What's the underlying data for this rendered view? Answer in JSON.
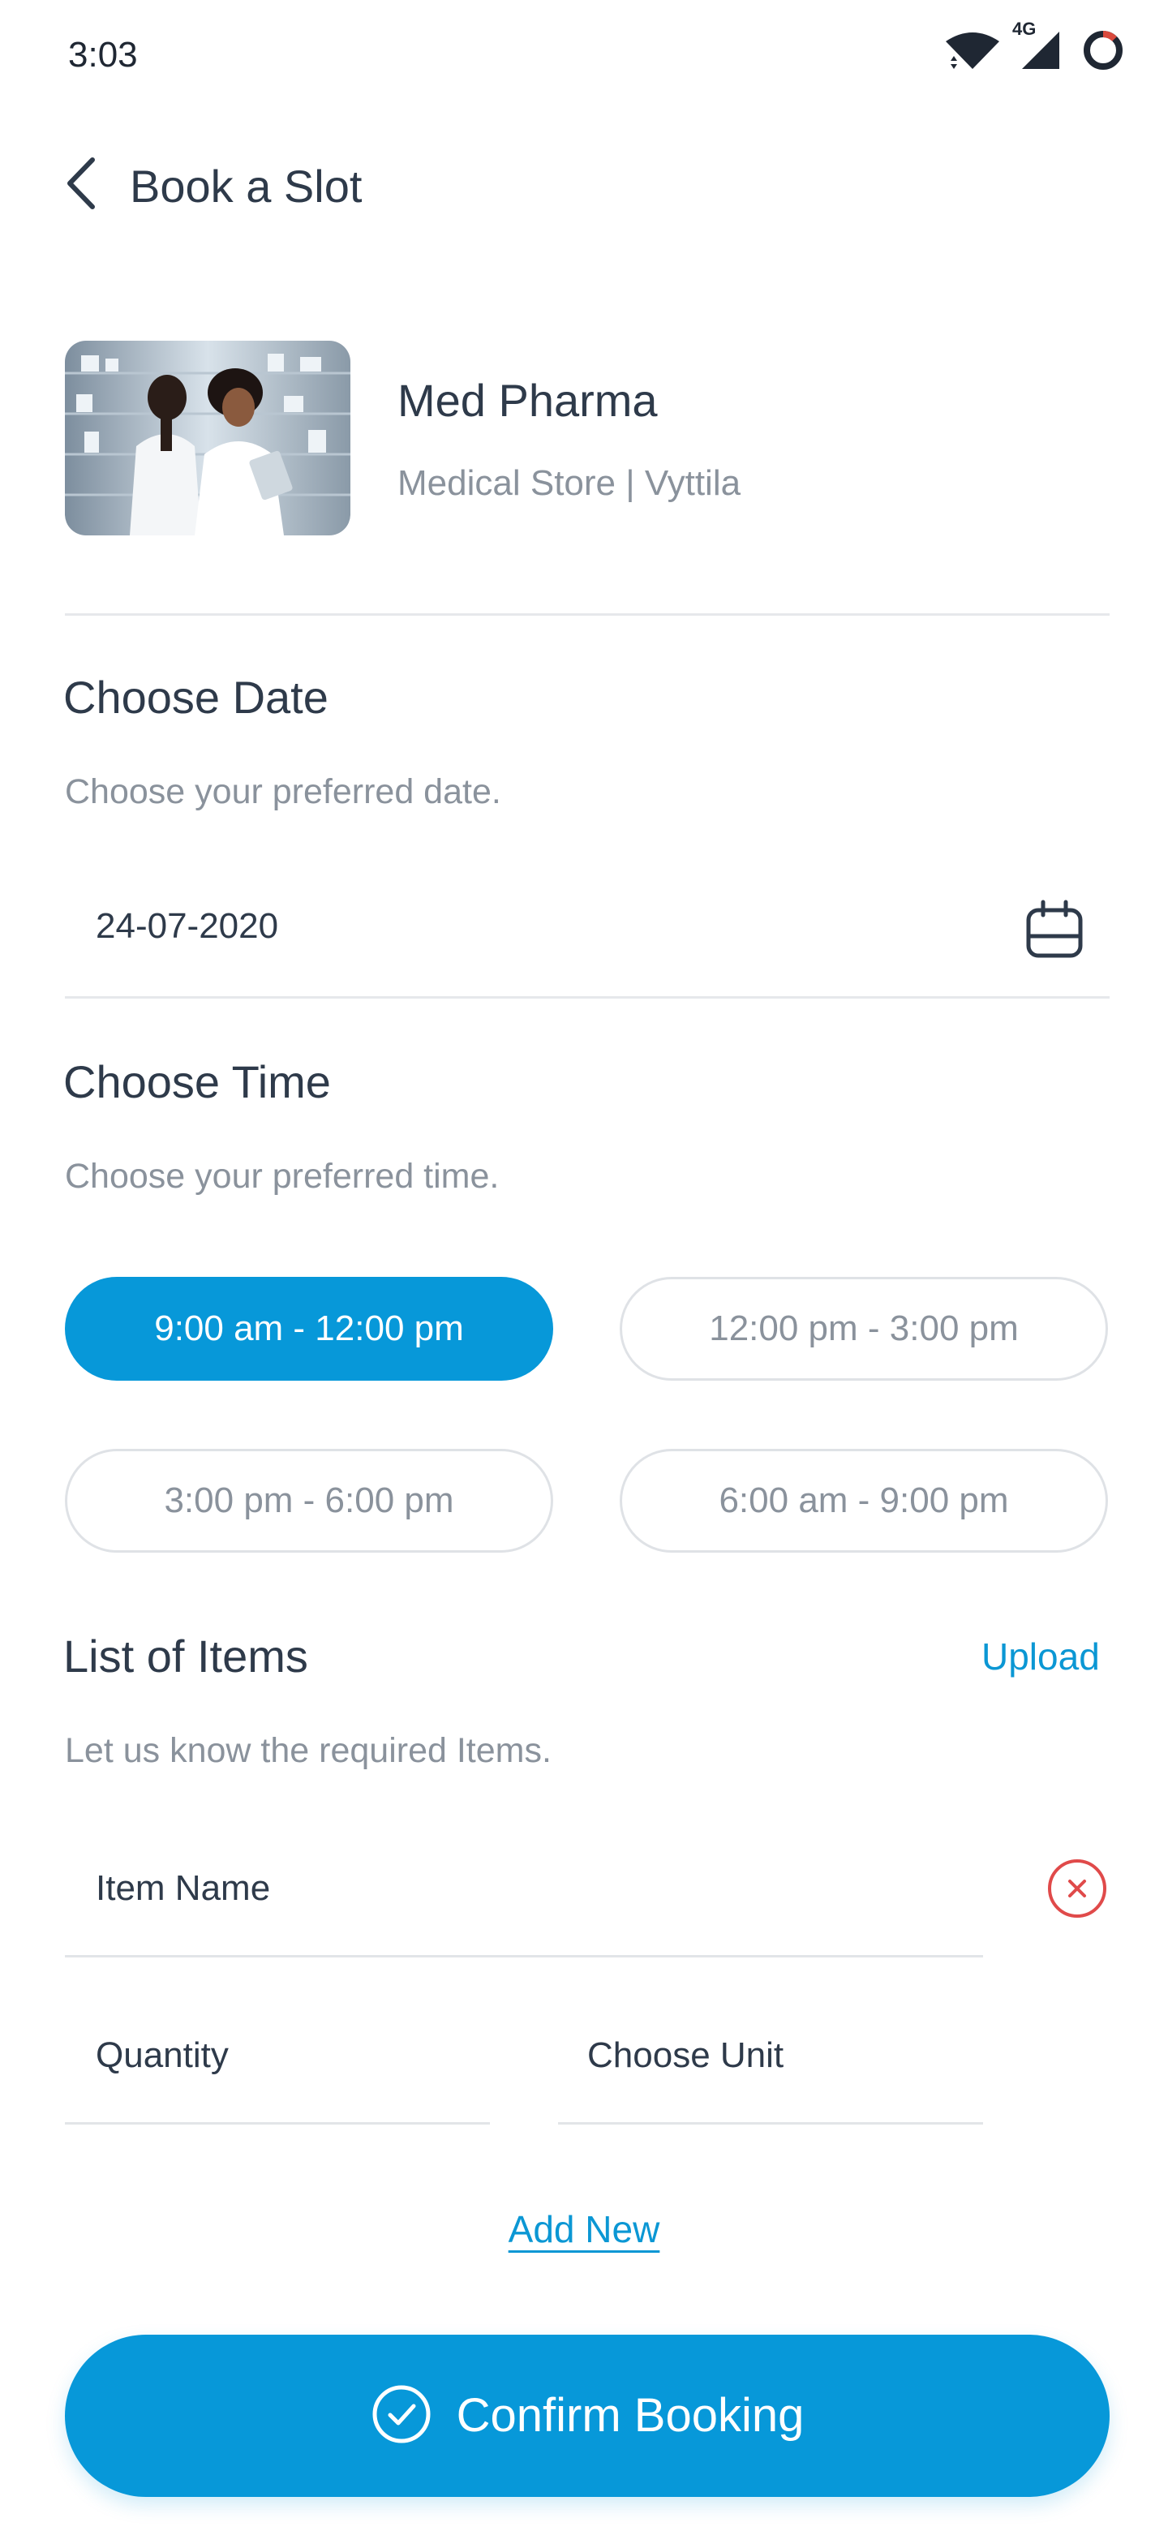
{
  "status_bar": {
    "time": "3:03",
    "network_label": "4G",
    "icons": [
      "wifi-icon",
      "signal-icon",
      "battery-icon"
    ]
  },
  "header": {
    "back_icon": "chevron-left-icon",
    "title": "Book a Slot"
  },
  "store": {
    "name": "Med Pharma",
    "subtitle": "Medical Store | Vyttila"
  },
  "date_section": {
    "title": "Choose Date",
    "description": "Choose your preferred date.",
    "value": "24-07-2020",
    "icon": "calendar-icon"
  },
  "time_section": {
    "title": "Choose Time",
    "description": "Choose your preferred time.",
    "slots": [
      {
        "label": "9:00 am - 12:00 pm",
        "selected": true
      },
      {
        "label": "12:00 pm - 3:00 pm",
        "selected": false
      },
      {
        "label": "3:00 pm - 6:00 pm",
        "selected": false
      },
      {
        "label": "6:00 am - 9:00 pm",
        "selected": false
      }
    ]
  },
  "items_section": {
    "title": "List of Items",
    "upload_label": "Upload",
    "description": "Let us know the required Items.",
    "item_name_placeholder": "Item Name",
    "quantity_placeholder": "Quantity",
    "unit_placeholder": "Choose Unit",
    "add_new_label": "Add New"
  },
  "confirm": {
    "label": "Confirm Booking",
    "icon": "check-circle-icon"
  },
  "colors": {
    "accent": "#0798d9",
    "text_primary": "#2e3a4a",
    "text_secondary": "#8a929c",
    "danger": "#e04a4a"
  }
}
